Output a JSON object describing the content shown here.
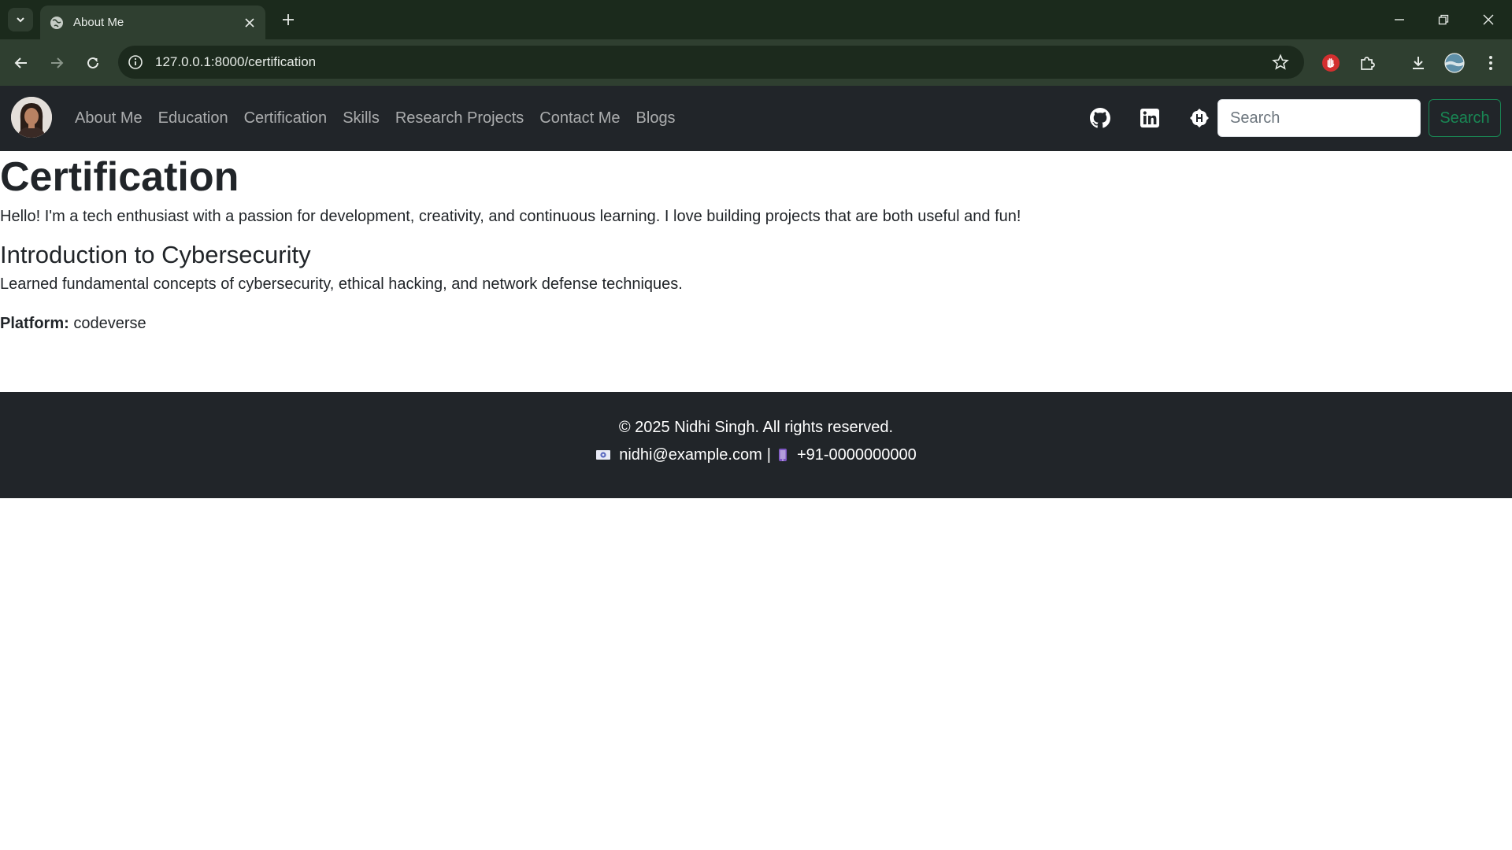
{
  "browser": {
    "tab_title": "About Me",
    "url": "127.0.0.1:8000/certification"
  },
  "navbar": {
    "links": [
      "About Me",
      "Education",
      "Certification",
      "Skills",
      "Research Projects",
      "Contact Me",
      "Blogs"
    ],
    "search_placeholder": "Search",
    "search_button": "Search",
    "icons": [
      "github-icon",
      "linkedin-icon",
      "hashnode-icon"
    ]
  },
  "main": {
    "title": "Certification",
    "intro": "Hello! I'm a tech enthusiast with a passion for development, creativity, and continuous learning. I love building projects that are both useful and fun!",
    "certifications": [
      {
        "title": "Introduction to Cybersecurity",
        "description": "Learned fundamental concepts of cybersecurity, ethical hacking, and network defense techniques.",
        "platform_label": "Platform:",
        "platform": "codeverse"
      }
    ]
  },
  "footer": {
    "copyright": "© 2025 Nidhi Singh. All rights reserved.",
    "email": "nidhi@example.com",
    "separator": "|",
    "phone": "+91-0000000000"
  },
  "colors": {
    "tabbar": "#1b2a1c",
    "toolbar": "#2f3f30",
    "navbar": "#212529",
    "search_button": "#198754"
  }
}
